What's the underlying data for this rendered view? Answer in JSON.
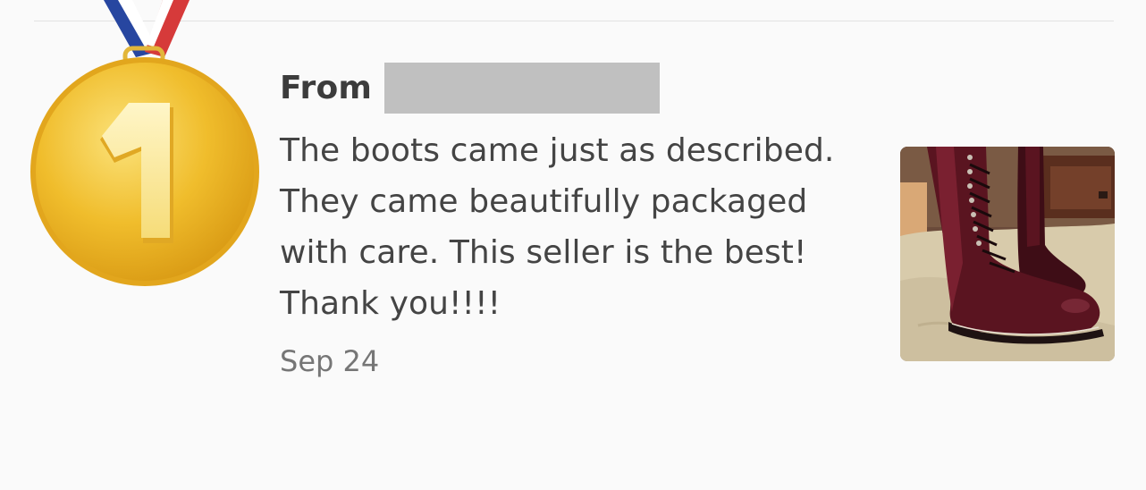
{
  "review": {
    "from_label": "From",
    "reviewer_name_redacted": "",
    "text": "The boots came just as described. They came beautifully packaged with care. This seller is the best! Thank you!!!!",
    "date": "Sep 24"
  },
  "badge": {
    "icon": "first-place-medal-icon",
    "number": "1",
    "colors": {
      "gold": "#f2c12e",
      "ribbon_blue": "#2746a0",
      "ribbon_red": "#d63a3a"
    }
  },
  "photo": {
    "icon": "boots-photo",
    "colors": {
      "boot_leather": "#5a1420",
      "blanket": "#d8cbab"
    }
  }
}
